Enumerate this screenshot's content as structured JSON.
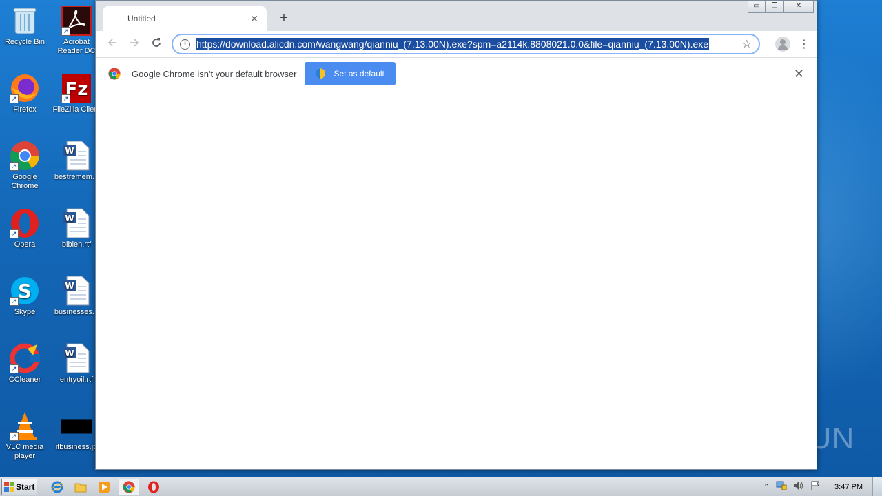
{
  "desktop": {
    "icons": [
      {
        "label": "Recycle Bin",
        "icon": "recycle-bin-icon"
      },
      {
        "label": "Acrobat Reader DC",
        "icon": "acrobat-icon"
      },
      {
        "label": "Firefox",
        "icon": "firefox-icon"
      },
      {
        "label": "FileZilla Client",
        "icon": "filezilla-icon"
      },
      {
        "label": "Google Chrome",
        "icon": "chrome-icon"
      },
      {
        "label": "bestremem...",
        "icon": "word-doc-icon"
      },
      {
        "label": "Opera",
        "icon": "opera-icon"
      },
      {
        "label": "bibleh.rtf",
        "icon": "word-doc-icon"
      },
      {
        "label": "Skype",
        "icon": "skype-icon"
      },
      {
        "label": "businesses...",
        "icon": "word-doc-icon"
      },
      {
        "label": "CCleaner",
        "icon": "ccleaner-icon"
      },
      {
        "label": "entryoil.rtf",
        "icon": "word-doc-icon"
      },
      {
        "label": "VLC media player",
        "icon": "vlc-icon"
      },
      {
        "label": "ifbusiness.jp",
        "icon": "image-file-icon"
      }
    ]
  },
  "browser": {
    "tab_title": "Untitled",
    "tab_close": "✕",
    "new_tab": "+",
    "window_controls": {
      "minimize": "▭",
      "maximize": "❐",
      "close": "✕"
    },
    "url": "https://download.alicdn.com/wangwang/qianniu_(7.13.00N).exe?spm=a2114k.8808021.0.0&file=qianniu_(7.13.00N).exe",
    "infobar": {
      "message": "Google Chrome isn't your default browser",
      "button_label": "Set as default",
      "close": "✕"
    }
  },
  "watermark": "ANY RUN",
  "taskbar": {
    "start_label": "Start",
    "clock": "3:47 PM",
    "tray_chevron": "⌃"
  },
  "colors": {
    "desktop_blue": "#1468b8",
    "omnibox_focus": "#8ab4f8",
    "url_selection": "#1b4da0",
    "set_default_button": "#4a8cf0"
  }
}
